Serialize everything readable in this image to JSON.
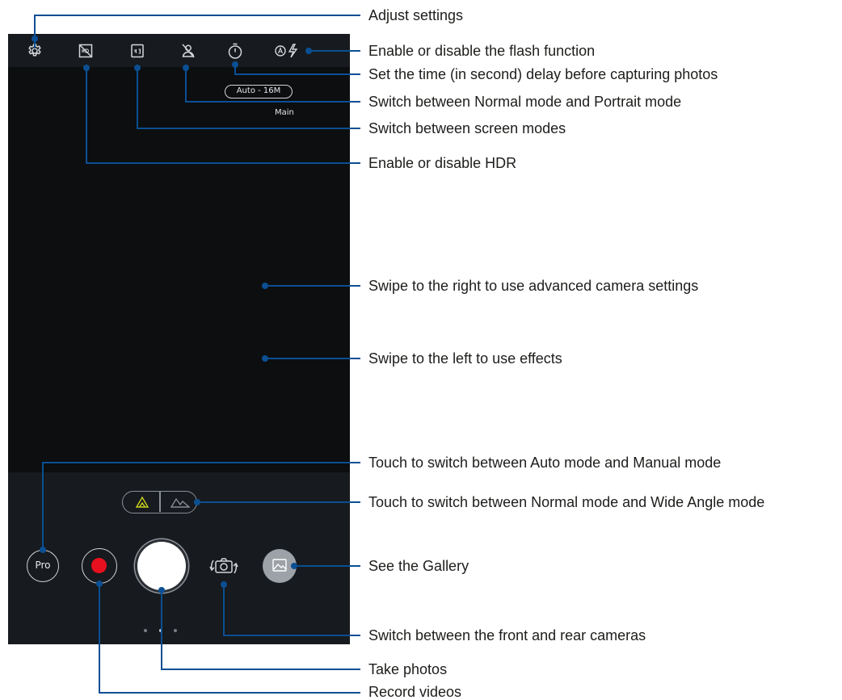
{
  "camera_screen": {
    "resolution_label": "Auto - 16M",
    "lens_label": "Main",
    "pro_button_label": "Pro",
    "top_icons": [
      "gear-icon",
      "hdr-off-icon",
      "aspect-ratio-icon",
      "portrait-off-icon",
      "timer-icon",
      "auto-flash-icon"
    ],
    "lens_modes": [
      "normal-lens-icon",
      "wide-angle-lens-icon"
    ],
    "colors": {
      "callout_line": "#0b4f93",
      "record": "#e8101e",
      "shutter": "#ffffff",
      "screen": "#171a1e"
    }
  },
  "callouts": [
    "Adjust settings",
    "Enable or disable the flash function",
    "Set the time (in second) delay before capturing photos",
    "Switch between Normal mode and Portrait mode",
    "Switch between screen modes",
    "Enable or disable HDR",
    "Swipe to the right to use advanced camera settings",
    "Swipe to the left to use effects",
    "Touch to switch between Auto mode and Manual mode",
    "Touch to switch between Normal mode and Wide Angle mode",
    "See the Gallery",
    "Switch between the front and rear cameras",
    "Take photos",
    "Record videos"
  ]
}
